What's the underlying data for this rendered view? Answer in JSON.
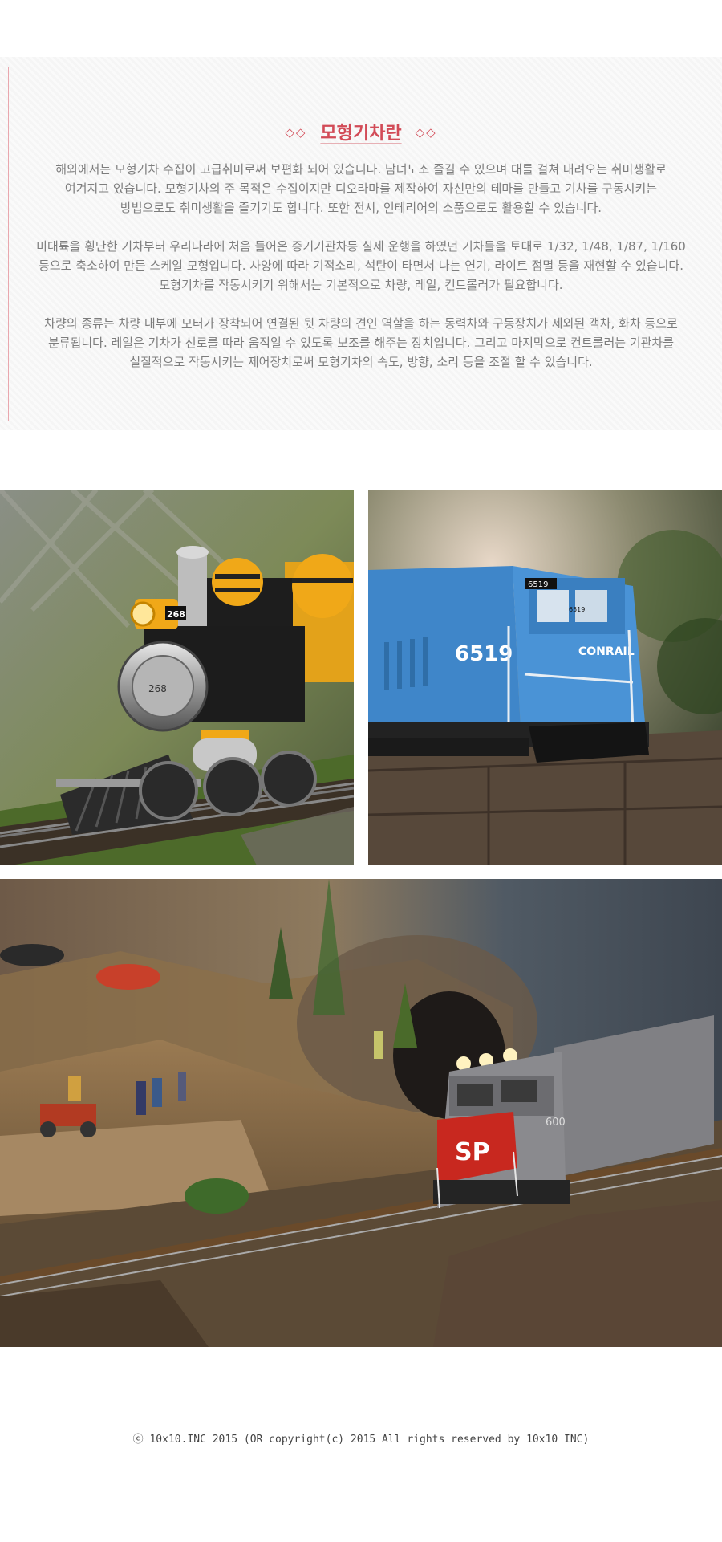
{
  "intro": {
    "title": "모형기차란",
    "title_decoration": "◇◇",
    "paragraphs": [
      [
        "해외에서는 모형기차 수집이 고급취미로써 보편화 되어 있습니다. 남녀노소 즐길 수 있으며 대를 걸쳐 내려오는 취미생활로",
        "여겨지고 있습니다. 모형기차의 주 목적은 수집이지만 디오라마를 제작하여 자신만의 테마를 만들고 기차를 구동시키는",
        "방법으로도 취미생활을 즐기기도 합니다. 또한 전시, 인테리어의 소품으로도 활용할 수 있습니다."
      ],
      [
        "미대륙을 횡단한 기차부터 우리나라에 처음 들어온 증기기관차등 실제 운행을 하였던 기차들을 토대로 1/32, 1/48, 1/87, 1/160",
        "등으로 축소하여 만든 스케일 모형입니다. 사양에 따라 기적소리, 석탄이 타면서 나는 연기, 라이트 점멸 등을 재현할 수 있습니다.",
        "모형기차를 작동시키기 위해서는 기본적으로 차량, 레일, 컨트롤러가 필요합니다."
      ],
      [
        "차량의 종류는 차량 내부에 모터가 장착되어 연결된 뒷 차량의 견인 역할을 하는 동력차와 구동장치가 제외된 객차, 화차 등으로",
        "분류됩니다. 레일은 기차가 선로를 따라 움직일 수 있도록 보조를 해주는 장치입니다. 그리고 마지막으로 컨트롤러는 기관차를",
        "실질적으로 작동시키는 제어장치로써 모형기차의 속도, 방향, 소리 등을 조절 할 수 있습니다."
      ]
    ]
  },
  "photos": {
    "steam": {
      "plate": "268",
      "front": "268"
    },
    "conrail": {
      "number": "6519",
      "cab_number": "6519",
      "small": "6519",
      "brand": "CONRAIL"
    },
    "sp": {
      "logo": "SP",
      "number": "600"
    }
  },
  "footer": {
    "copyright": "ⓒ 10x10.INC 2015 (OR copyright(c) 2015 All rights reserved by 10x10 INC)"
  },
  "colors": {
    "accent": "#d24b57",
    "border": "#e9a7ae",
    "conrail_blue": "#3f86c9",
    "sp_red": "#c8281f"
  }
}
